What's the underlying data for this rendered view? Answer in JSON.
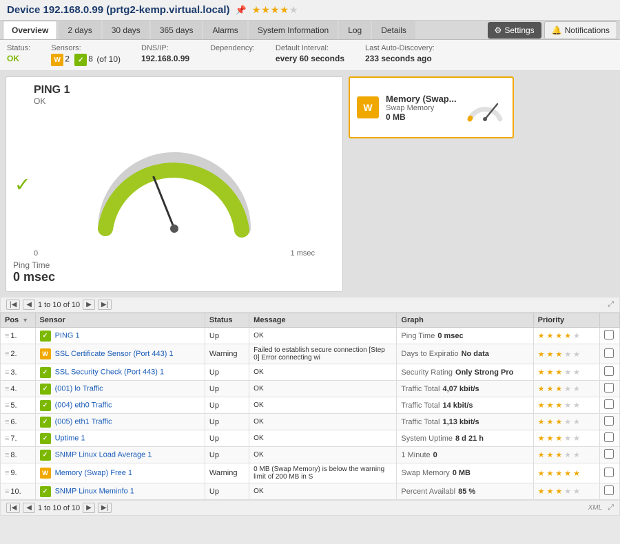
{
  "device": {
    "title": "Device 192.168.0.99 (prtg2-kemp.virtual.local)",
    "stars": "★★★★",
    "stars_empty": "★"
  },
  "tabs": [
    {
      "label": "Overview",
      "active": true
    },
    {
      "label": "2 days",
      "active": false
    },
    {
      "label": "30 days",
      "active": false
    },
    {
      "label": "365 days",
      "active": false
    },
    {
      "label": "Alarms",
      "active": false
    },
    {
      "label": "System Information",
      "active": false
    },
    {
      "label": "Log",
      "active": false
    },
    {
      "label": "Details",
      "active": false
    }
  ],
  "settings_label": "Settings",
  "notifications_label": "Notifications",
  "status_bar": {
    "status_label": "Status:",
    "status_value": "OK",
    "sensors_label": "Sensors:",
    "sensors_warning": "2",
    "sensors_ok": "8",
    "sensors_total": "(of 10)",
    "dns_label": "DNS/IP:",
    "dns_value": "192.168.0.99",
    "dependency_label": "Dependency:",
    "dependency_value": "",
    "default_interval_label": "Default Interval:",
    "default_interval_value": "every 60 seconds",
    "last_discovery_label": "Last Auto-Discovery:",
    "last_discovery_value": "233 seconds ago"
  },
  "ping_gauge": {
    "title": "PING 1",
    "status": "OK",
    "reading_label": "Ping Time",
    "reading_value": "0 msec",
    "scale_min": "0",
    "scale_max": "1 msec"
  },
  "memory_card": {
    "title": "Memory (Swap...",
    "subtitle": "Swap Memory",
    "value": "0 MB",
    "icon_label": "W"
  },
  "pagination": {
    "text": "1 to 10 of 10"
  },
  "table": {
    "headers": [
      "Pos",
      "Sensor",
      "Status",
      "Message",
      "Graph",
      "Priority",
      ""
    ],
    "rows": [
      {
        "pos": "1.",
        "sensor_icon": "✓",
        "sensor_icon_type": "ok",
        "sensor_name": "PING 1",
        "status": "Up",
        "message": "OK",
        "graph_label": "Ping Time",
        "graph_value": "0 msec",
        "priority": 4,
        "max_priority": 5
      },
      {
        "pos": "2.",
        "sensor_icon": "W",
        "sensor_icon_type": "warning",
        "sensor_name": "SSL Certificate Sensor (Port 443) 1",
        "status": "Warning",
        "message": "Failed to establish secure connection [Step 0] Error connecting wi",
        "graph_label": "Days to Expiratio",
        "graph_value": "No data",
        "priority": 3,
        "max_priority": 5
      },
      {
        "pos": "3.",
        "sensor_icon": "✓",
        "sensor_icon_type": "ok",
        "sensor_name": "SSL Security Check (Port 443) 1",
        "status": "Up",
        "message": "OK",
        "graph_label": "Security Rating",
        "graph_value": "Only Strong Pro",
        "priority": 3,
        "max_priority": 5
      },
      {
        "pos": "4.",
        "sensor_icon": "✓",
        "sensor_icon_type": "ok",
        "sensor_name": "(001) lo Traffic",
        "status": "Up",
        "message": "OK",
        "graph_label": "Traffic Total",
        "graph_value": "4,07 kbit/s",
        "priority": 3,
        "max_priority": 5
      },
      {
        "pos": "5.",
        "sensor_icon": "✓",
        "sensor_icon_type": "ok",
        "sensor_name": "(004) eth0 Traffic",
        "status": "Up",
        "message": "OK",
        "graph_label": "Traffic Total",
        "graph_value": "14 kbit/s",
        "priority": 3,
        "max_priority": 5
      },
      {
        "pos": "6.",
        "sensor_icon": "✓",
        "sensor_icon_type": "ok",
        "sensor_name": "(005) eth1 Traffic",
        "status": "Up",
        "message": "OK",
        "graph_label": "Traffic Total",
        "graph_value": "1,13 kbit/s",
        "priority": 3,
        "max_priority": 5
      },
      {
        "pos": "7.",
        "sensor_icon": "✓",
        "sensor_icon_type": "ok",
        "sensor_name": "Uptime 1",
        "status": "Up",
        "message": "OK",
        "graph_label": "System Uptime",
        "graph_value": "8 d 21 h",
        "priority": 3,
        "max_priority": 5
      },
      {
        "pos": "8.",
        "sensor_icon": "✓",
        "sensor_icon_type": "ok",
        "sensor_name": "SNMP Linux Load Average 1",
        "status": "Up",
        "message": "OK",
        "graph_label": "1 Minute",
        "graph_value": "0",
        "priority": 3,
        "max_priority": 5
      },
      {
        "pos": "9.",
        "sensor_icon": "W",
        "sensor_icon_type": "warning",
        "sensor_name": "Memory (Swap) Free 1",
        "status": "Warning",
        "message": "0 MB (Swap Memory) is below the warning limit of 200 MB in S",
        "graph_label": "Swap Memory",
        "graph_value": "0 MB",
        "priority": 5,
        "max_priority": 5
      },
      {
        "pos": "10.",
        "sensor_icon": "✓",
        "sensor_icon_type": "ok",
        "sensor_name": "SNMP Linux Meminfo 1",
        "status": "Up",
        "message": "OK",
        "graph_label": "Percent Availabl",
        "graph_value": "85 %",
        "priority": 3,
        "max_priority": 5
      }
    ]
  },
  "bottom_pagination": {
    "text": "1 to 10 of 10"
  },
  "xml_label": "XML",
  "colors": {
    "ok_green": "#7cb800",
    "warning_yellow": "#f0a800",
    "link_blue": "#1a5cb8",
    "header_bg": "#e0e0e0"
  }
}
